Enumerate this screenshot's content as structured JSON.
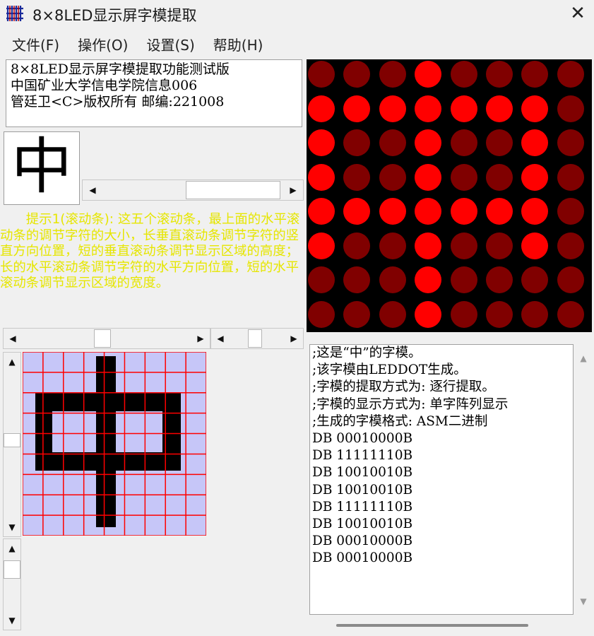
{
  "window": {
    "title": "8×8LED显示屏字模提取",
    "close_glyph": "✕"
  },
  "menu": [
    "文件(F)",
    "操作(O)",
    "设置(S)",
    "帮助(H)"
  ],
  "info_lines": [
    "8×8LED显示屏字模提取功能测试版",
    "中国矿业大学信电学院信息006",
    "管廷卫<C>版权所有 邮编:221008"
  ],
  "preview_char": "中",
  "hint_text": "　　提示1(滚动条): 这五个滚动条，最上面的水平滚动条的调节字符的大小，长垂直滚动条调节字符的竖直方向位置，短的垂直滚动条调节显示区域的高度；长的水平滚动条调节字符的水平方向位置，短的水平滚动条调节显示区域的宽度。",
  "led": {
    "on_color": "#ff0000",
    "off_color": "#800000",
    "rows": [
      "00010000",
      "11111110",
      "10010010",
      "10010010",
      "11111110",
      "10010010",
      "00010000",
      "00010000"
    ]
  },
  "grid": {
    "cell_color": "#c6c6f8",
    "line_color": "#ff0000",
    "char_color": "#000000"
  },
  "code": {
    "lines": [
      ";这是“中”的字模。",
      ";该字模由LEDDOT生成。",
      ";字模的提取方式为: 逐行提取。",
      ";字模的显示方式为: 单字阵列显示",
      ";生成的字模格式: ASM二进制",
      "DB 00010000B",
      "DB 11111110B",
      "DB 10010010B",
      "DB 10010010B",
      "DB 11111110B",
      "DB 10010010B",
      "DB 00010000B",
      "DB 00010000B"
    ]
  },
  "icons": {
    "app": "led-grid-icon",
    "close": "close-icon",
    "arrows": [
      "arrow-left-icon",
      "arrow-right-icon",
      "arrow-up-icon",
      "arrow-down-icon"
    ]
  }
}
